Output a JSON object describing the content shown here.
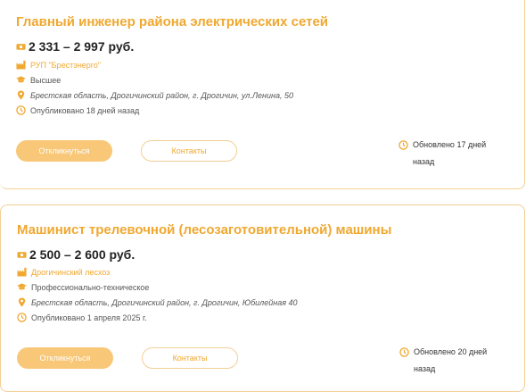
{
  "colors": {
    "accent": "#f0a830",
    "button_fill": "#f8c777",
    "border": "#f3cf95"
  },
  "jobs": [
    {
      "title": "Главный инженер района электрических сетей",
      "salary": "2 331 – 2 997 руб.",
      "company": "РУП \"Брестэнерго\"",
      "education": "Высшее",
      "address": "Брестская область, Дрогичинский район, г. Дрогичин, ул.Ленина, 50",
      "published": "Опубликовано 18 дней назад",
      "respond_label": "Откликнуться",
      "contacts_label": "Контакты",
      "updated": "Обновлено 17 дней назад"
    },
    {
      "title": "Машинист трелевочной (лесозаготовительной) машины",
      "salary": "2 500 – 2 600 руб.",
      "company": "Дрогичинский лесхоз",
      "education": "Профессионально-техническое",
      "address": "Брестская область, Дрогичинский район, г. Дрогичин, Юбилейная 40",
      "published": "Опубликовано 1 апреля 2025 г.",
      "respond_label": "Откликнуться",
      "contacts_label": "Контакты",
      "updated": "Обновлено 20 дней назад"
    }
  ],
  "icons": {
    "salary": "money-icon",
    "company": "factory-icon",
    "education": "graduation-cap-icon",
    "address": "location-pin-icon",
    "published": "clock-icon",
    "updated": "clock-icon"
  }
}
